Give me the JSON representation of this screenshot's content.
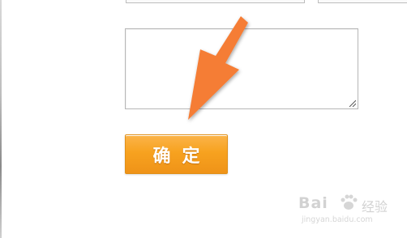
{
  "form": {
    "confirm_label": "确定"
  },
  "icons": {
    "pointer_arrow": "arrow-icon",
    "resize_grip": "resize-grip-icon",
    "watermark_paw": "paw-icon"
  },
  "colors": {
    "button_orange": "#f7a21f",
    "arrow_orange": "#f57d36"
  },
  "watermark": {
    "brand": "Bai",
    "product": "经验",
    "url": "jingyan.baidu.com"
  }
}
